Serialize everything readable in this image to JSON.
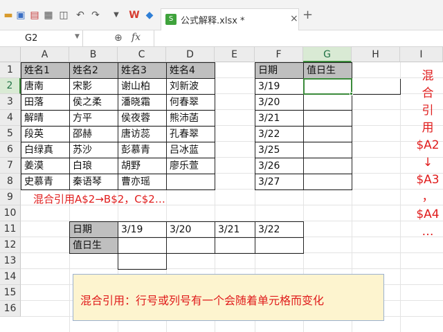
{
  "toolbar": {
    "icons": [
      "folder-icon",
      "save-icon",
      "export-pdf-icon",
      "print-icon",
      "print-preview-icon",
      "undo-icon",
      "redo-icon",
      "dropdown-icon"
    ],
    "wps_logo": "W",
    "tab_title": "公式解释.xlsx *",
    "tab_close": "×",
    "tab_add": "+"
  },
  "formula_bar": {
    "name_box": "G2",
    "fx": "fx",
    "formula": ""
  },
  "columns": [
    "A",
    "B",
    "C",
    "D",
    "E",
    "F",
    "G",
    "H",
    "I"
  ],
  "rows": [
    "1",
    "2",
    "3",
    "4",
    "5",
    "6",
    "7",
    "8",
    "9",
    "10",
    "11",
    "12",
    "13",
    "14",
    "15",
    "16"
  ],
  "selected_cell": "G2",
  "names_table": {
    "headers": [
      "姓名1",
      "姓名2",
      "姓名3",
      "姓名4"
    ],
    "rows": [
      [
        "唐南",
        "宋影",
        "谢山柏",
        "刘新波"
      ],
      [
        "田落",
        "侯之柔",
        "潘晓霜",
        "何春翠"
      ],
      [
        "解晴",
        "方平",
        "侯夜蓉",
        "熊沛菡"
      ],
      [
        "段英",
        "邵赫",
        "唐访蕊",
        "孔春翠"
      ],
      [
        "白绿真",
        "苏沙",
        "彭慕青",
        "吕冰蓝"
      ],
      [
        "姜漠",
        "白琅",
        "胡野",
        "廖乐萱"
      ],
      [
        "史慕青",
        "秦语琴",
        "曹亦瑶",
        ""
      ]
    ]
  },
  "duty_table": {
    "headers": [
      "日期",
      "值日生"
    ],
    "dates": [
      "3/19",
      "3/20",
      "3/21",
      "3/22",
      "3/25",
      "3/26",
      "3/27"
    ]
  },
  "cross_table": {
    "row1_label": "日期",
    "row2_label": "值日生",
    "dates": [
      "3/19",
      "3/20",
      "3/21",
      "3/22"
    ]
  },
  "annotations": {
    "mixed_row_note": "混合引用A$2→B$2，C$2…",
    "vertical_note": [
      "混",
      "合",
      "引",
      "用",
      "$A2",
      "↓",
      "$A3",
      "，",
      "$A4",
      "…"
    ],
    "box_note": "混合引用：行号或列号有一个会随着单元格而变化",
    "accent_color": "#e01c1c",
    "selection_color": "#3a8a3a"
  }
}
